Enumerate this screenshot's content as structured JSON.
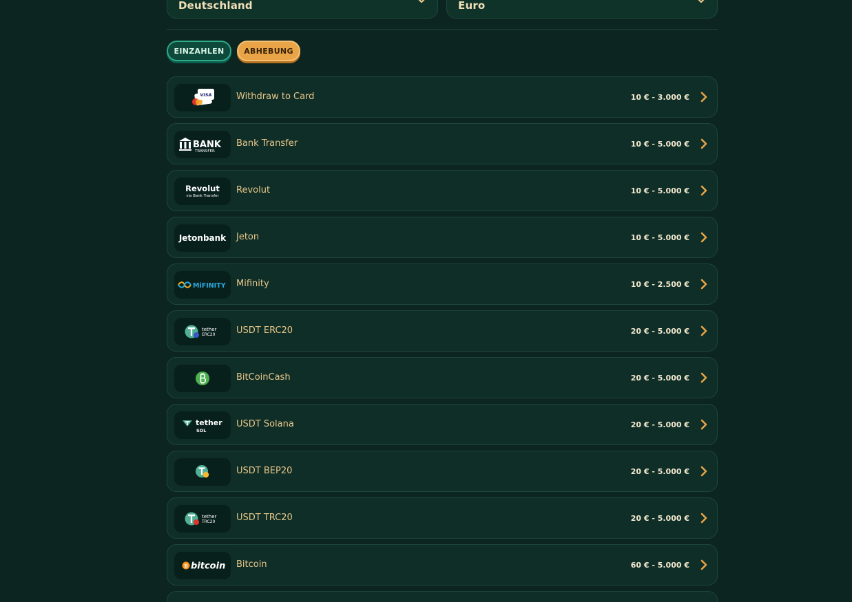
{
  "selects": {
    "country": "Deutschland",
    "currency": "Euro"
  },
  "tabs": {
    "deposit": "EINZAHLEN",
    "withdraw": "ABHEBUNG"
  },
  "logos": {
    "visa": "VISA",
    "bank_1": "BANK",
    "bank_2": "TRANSFER",
    "revolut_1": "Revolut",
    "revolut_2": "via Bank Transfer",
    "jetonbank": "Jetonbank",
    "mifinity": "MiFINITY",
    "tether": "tether",
    "erc20": "ERC20",
    "sol": "SOL",
    "trc20": "TRC20",
    "bitcoin": "bitcoin"
  },
  "methods": [
    {
      "name": "Withdraw to Card",
      "range": "10 € - 3.000 €",
      "icon": "card-icon"
    },
    {
      "name": "Bank Transfer",
      "range": "10 € - 5.000 €",
      "icon": "bank-transfer-icon"
    },
    {
      "name": "Revolut",
      "range": "10 € - 5.000 €",
      "icon": "revolut-icon"
    },
    {
      "name": "Jeton",
      "range": "10 € - 5.000 €",
      "icon": "jetonbank-icon"
    },
    {
      "name": "Mifinity",
      "range": "10 € - 2.500 €",
      "icon": "mifinity-icon"
    },
    {
      "name": "USDT ERC20",
      "range": "20 € - 5.000 €",
      "icon": "tether-erc20-icon"
    },
    {
      "name": "BitCoinCash",
      "range": "20 € - 5.000 €",
      "icon": "bitcoincash-icon"
    },
    {
      "name": "USDT Solana",
      "range": "20 € - 5.000 €",
      "icon": "tether-sol-icon"
    },
    {
      "name": "USDT BEP20",
      "range": "20 € - 5.000 €",
      "icon": "tether-bep20-icon"
    },
    {
      "name": "USDT TRC20",
      "range": "20 € - 5.000 €",
      "icon": "tether-trc20-icon"
    },
    {
      "name": "Bitcoin",
      "range": "60 € - 5.000 €",
      "icon": "bitcoin-icon"
    }
  ],
  "colors": {
    "background": "#0d2520",
    "accent_gold": "#e8a447",
    "accent_green": "#2fa988",
    "method_text": "#e8c78a"
  }
}
